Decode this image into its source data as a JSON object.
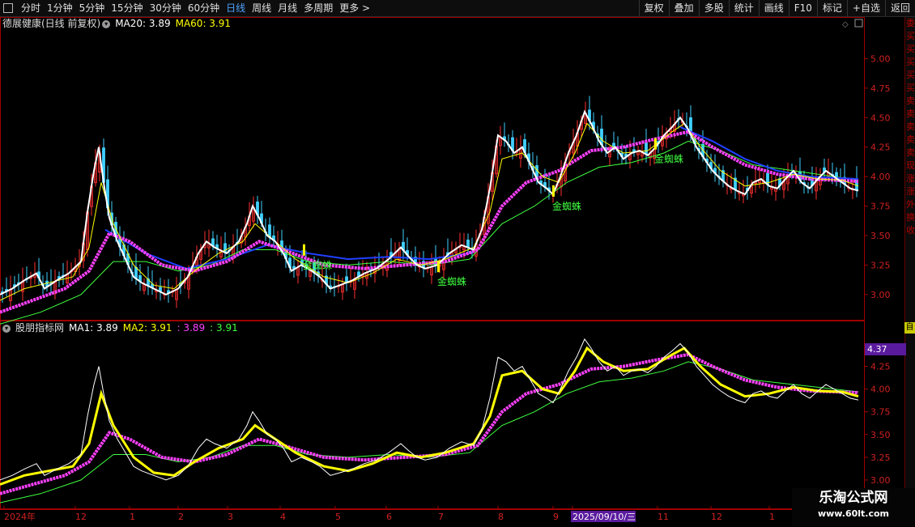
{
  "toolbar": {
    "left": [
      "分时",
      "1分钟",
      "5分钟",
      "15分钟",
      "30分钟",
      "60分钟",
      "日线",
      "周线",
      "月线",
      "多周期",
      "更多 >"
    ],
    "active": "日线",
    "right": [
      "复权",
      "叠加",
      "多股",
      "统计",
      "画线",
      "F10",
      "标记",
      "+自选",
      "返回"
    ]
  },
  "main_header": {
    "stock": "德展健康(日线 前复权)",
    "ma20": "MA20: 3.89",
    "ma60": "MA60: 3.91"
  },
  "sub_header": {
    "name": "股朋指标网",
    "ma1": "MA1: 3.89",
    "ma2": "MA2: 3.91",
    "v3": ": 3.89",
    "v4": ": 3.91"
  },
  "signal_label": "金蜘蛛",
  "cursor_price": "4.37",
  "cursor_date": "2025/09/10/三",
  "right_panel_chars": [
    "委",
    "买",
    "买",
    "买",
    "买",
    "买",
    "卖",
    "卖",
    "卖",
    "卖",
    "卖",
    "现",
    "涨",
    "涨",
    "外",
    "换",
    "收"
  ],
  "yellow_tag": "自",
  "watermark": {
    "title": "乐淘公式网",
    "url": "www.60lt.com"
  },
  "colors": {
    "up": "#ff3030",
    "down": "#40d0ff",
    "ma_white": "#ffffff",
    "ma_yellow": "#ffff00",
    "ma_magenta": "#ff40ff",
    "ma_green": "#40ff40",
    "ma_blue": "#2040ff",
    "axis": "#a00000"
  },
  "chart_data": [
    {
      "type": "line",
      "title": "德展健康(日线 前复权)",
      "y_ticks": [
        3.0,
        3.25,
        3.5,
        3.75,
        4.0,
        4.25,
        4.5,
        4.75,
        5.0
      ],
      "ylim": [
        2.8,
        5.25
      ],
      "x_labels": [
        "2024年",
        "12",
        "1",
        "2",
        "3",
        "4",
        "5",
        "6",
        "7",
        "8",
        "9",
        "2025/09/10/三",
        "11",
        "12",
        "1"
      ],
      "price": [
        [
          0,
          3.0
        ],
        [
          15,
          3.05
        ],
        [
          30,
          3.12
        ],
        [
          45,
          3.18
        ],
        [
          55,
          3.05
        ],
        [
          70,
          3.12
        ],
        [
          85,
          3.18
        ],
        [
          100,
          3.28
        ],
        [
          108,
          3.7
        ],
        [
          116,
          4.05
        ],
        [
          122,
          4.25
        ],
        [
          128,
          3.95
        ],
        [
          135,
          3.65
        ],
        [
          145,
          3.45
        ],
        [
          155,
          3.3
        ],
        [
          165,
          3.15
        ],
        [
          175,
          3.1
        ],
        [
          190,
          3.05
        ],
        [
          205,
          3.0
        ],
        [
          220,
          3.05
        ],
        [
          232,
          3.15
        ],
        [
          245,
          3.35
        ],
        [
          255,
          3.45
        ],
        [
          265,
          3.4
        ],
        [
          280,
          3.35
        ],
        [
          295,
          3.45
        ],
        [
          305,
          3.6
        ],
        [
          312,
          3.75
        ],
        [
          320,
          3.65
        ],
        [
          330,
          3.5
        ],
        [
          340,
          3.45
        ],
        [
          350,
          3.35
        ],
        [
          360,
          3.2
        ],
        [
          372,
          3.25
        ],
        [
          385,
          3.2
        ],
        [
          395,
          3.15
        ],
        [
          408,
          3.05
        ],
        [
          420,
          3.08
        ],
        [
          435,
          3.12
        ],
        [
          450,
          3.18
        ],
        [
          465,
          3.22
        ],
        [
          480,
          3.3
        ],
        [
          495,
          3.4
        ],
        [
          505,
          3.32
        ],
        [
          515,
          3.25
        ],
        [
          525,
          3.22
        ],
        [
          540,
          3.25
        ],
        [
          555,
          3.35
        ],
        [
          570,
          3.42
        ],
        [
          585,
          3.38
        ],
        [
          595,
          3.55
        ],
        [
          605,
          3.9
        ],
        [
          615,
          4.35
        ],
        [
          625,
          4.3
        ],
        [
          635,
          4.2
        ],
        [
          645,
          4.25
        ],
        [
          655,
          4.1
        ],
        [
          665,
          3.95
        ],
        [
          675,
          3.9
        ],
        [
          683,
          3.85
        ],
        [
          692,
          4.0
        ],
        [
          702,
          4.2
        ],
        [
          712,
          4.35
        ],
        [
          722,
          4.55
        ],
        [
          730,
          4.45
        ],
        [
          740,
          4.3
        ],
        [
          750,
          4.2
        ],
        [
          760,
          4.25
        ],
        [
          770,
          4.15
        ],
        [
          780,
          4.2
        ],
        [
          790,
          4.22
        ],
        [
          800,
          4.18
        ],
        [
          810,
          4.25
        ],
        [
          820,
          4.35
        ],
        [
          830,
          4.42
        ],
        [
          840,
          4.5
        ],
        [
          850,
          4.4
        ],
        [
          860,
          4.25
        ],
        [
          870,
          4.15
        ],
        [
          880,
          4.05
        ],
        [
          890,
          3.98
        ],
        [
          900,
          3.92
        ],
        [
          910,
          3.88
        ],
        [
          920,
          3.85
        ],
        [
          930,
          3.95
        ],
        [
          940,
          3.98
        ],
        [
          950,
          3.92
        ],
        [
          960,
          3.9
        ],
        [
          970,
          3.98
        ],
        [
          980,
          4.05
        ],
        [
          990,
          3.95
        ],
        [
          1000,
          3.9
        ],
        [
          1010,
          3.98
        ],
        [
          1020,
          4.05
        ],
        [
          1030,
          4.0
        ],
        [
          1040,
          3.95
        ],
        [
          1050,
          3.9
        ],
        [
          1060,
          3.88
        ]
      ],
      "ma_yellow": [
        [
          0,
          2.95
        ],
        [
          30,
          3.05
        ],
        [
          60,
          3.1
        ],
        [
          90,
          3.15
        ],
        [
          110,
          3.4
        ],
        [
          125,
          3.95
        ],
        [
          140,
          3.6
        ],
        [
          165,
          3.25
        ],
        [
          190,
          3.08
        ],
        [
          215,
          3.05
        ],
        [
          240,
          3.2
        ],
        [
          270,
          3.35
        ],
        [
          300,
          3.45
        ],
        [
          315,
          3.6
        ],
        [
          335,
          3.48
        ],
        [
          365,
          3.3
        ],
        [
          400,
          3.15
        ],
        [
          430,
          3.1
        ],
        [
          460,
          3.18
        ],
        [
          490,
          3.3
        ],
        [
          520,
          3.25
        ],
        [
          550,
          3.3
        ],
        [
          585,
          3.4
        ],
        [
          605,
          3.7
        ],
        [
          620,
          4.15
        ],
        [
          645,
          4.2
        ],
        [
          670,
          4.0
        ],
        [
          690,
          3.95
        ],
        [
          710,
          4.2
        ],
        [
          725,
          4.45
        ],
        [
          745,
          4.3
        ],
        [
          770,
          4.2
        ],
        [
          800,
          4.22
        ],
        [
          830,
          4.38
        ],
        [
          845,
          4.45
        ],
        [
          865,
          4.25
        ],
        [
          890,
          4.05
        ],
        [
          920,
          3.92
        ],
        [
          950,
          3.95
        ],
        [
          980,
          4.02
        ],
        [
          1010,
          3.98
        ],
        [
          1040,
          3.97
        ],
        [
          1060,
          3.92
        ]
      ],
      "ma_magenta": [
        [
          0,
          2.85
        ],
        [
          40,
          2.95
        ],
        [
          80,
          3.05
        ],
        [
          110,
          3.2
        ],
        [
          135,
          3.52
        ],
        [
          160,
          3.45
        ],
        [
          200,
          3.25
        ],
        [
          240,
          3.2
        ],
        [
          280,
          3.28
        ],
        [
          320,
          3.45
        ],
        [
          350,
          3.38
        ],
        [
          400,
          3.25
        ],
        [
          450,
          3.22
        ],
        [
          500,
          3.25
        ],
        [
          550,
          3.28
        ],
        [
          590,
          3.38
        ],
        [
          620,
          3.75
        ],
        [
          650,
          3.95
        ],
        [
          690,
          4.05
        ],
        [
          730,
          4.22
        ],
        [
          770,
          4.25
        ],
        [
          810,
          4.32
        ],
        [
          850,
          4.38
        ],
        [
          880,
          4.25
        ],
        [
          920,
          4.1
        ],
        [
          960,
          4.02
        ],
        [
          1000,
          3.98
        ],
        [
          1060,
          3.96
        ]
      ],
      "ma_green": [
        [
          0,
          2.75
        ],
        [
          50,
          2.85
        ],
        [
          100,
          3.0
        ],
        [
          140,
          3.28
        ],
        [
          180,
          3.28
        ],
        [
          220,
          3.2
        ],
        [
          260,
          3.25
        ],
        [
          300,
          3.38
        ],
        [
          340,
          3.38
        ],
        [
          380,
          3.28
        ],
        [
          430,
          3.25
        ],
        [
          480,
          3.28
        ],
        [
          530,
          3.25
        ],
        [
          580,
          3.3
        ],
        [
          620,
          3.6
        ],
        [
          660,
          3.75
        ],
        [
          700,
          3.95
        ],
        [
          740,
          4.08
        ],
        [
          780,
          4.12
        ],
        [
          820,
          4.2
        ],
        [
          850,
          4.3
        ],
        [
          890,
          4.22
        ],
        [
          930,
          4.1
        ],
        [
          980,
          4.05
        ],
        [
          1060,
          3.97
        ]
      ],
      "ma_blue": [
        [
          130,
          3.55
        ],
        [
          180,
          3.35
        ],
        [
          230,
          3.22
        ],
        [
          280,
          3.3
        ],
        [
          330,
          3.42
        ],
        [
          380,
          3.35
        ],
        [
          430,
          3.3
        ],
        [
          480,
          3.32
        ],
        [
          530,
          3.3
        ],
        [
          580,
          3.35
        ],
        [
          840,
          4.42
        ],
        [
          880,
          4.3
        ],
        [
          920,
          4.15
        ],
        [
          960,
          4.05
        ],
        [
          1000,
          4.0
        ],
        [
          1060,
          3.98
        ]
      ],
      "signals": [
        [
          392,
          3.22
        ],
        [
          558,
          3.08
        ],
        [
          700,
          3.72
        ],
        [
          826,
          4.12
        ]
      ]
    },
    {
      "type": "line",
      "title": "股朋指标网",
      "y_ticks": [
        3.0,
        3.25,
        3.5,
        3.75,
        4.0,
        4.25
      ],
      "ylim": [
        2.75,
        4.62
      ],
      "series": [
        {
          "name": "MA1",
          "values": "price"
        },
        {
          "name": "MA2",
          "values": "ma_magenta"
        }
      ]
    }
  ]
}
